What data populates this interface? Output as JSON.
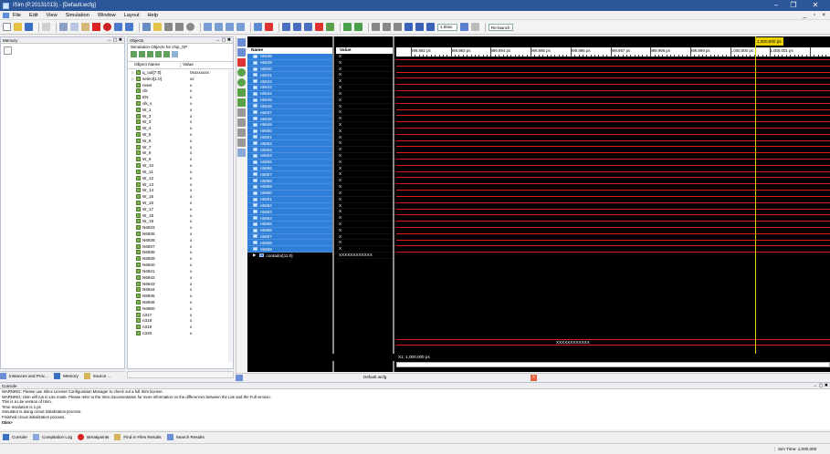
{
  "window": {
    "title": "ISim (P.20131013) - [Default.wcfg]",
    "min": "–",
    "max": "❐",
    "close": "✕",
    "inner_min": "_",
    "inner_restore": "▫",
    "inner_close": "×"
  },
  "menu": [
    "File",
    "Edit",
    "View",
    "Simulation",
    "Window",
    "Layout",
    "Help"
  ],
  "toolbar": {
    "run_time": "1.00us",
    "relaunch": "Re-launch",
    "icons": [
      "new-icon",
      "open-icon",
      "save-icon",
      "print-icon",
      "cut-icon",
      "copy-icon",
      "paste-icon",
      "delete-icon",
      "undo-icon",
      "redo-icon",
      "find-icon",
      "zoom-icon",
      "arrow-down-icon",
      "arrow-up-icon",
      "settings-icon",
      "layout-icon"
    ]
  },
  "memory_panel": {
    "title": "Memory"
  },
  "objects_panel": {
    "title": "Objects",
    "subtitle": "Simulation Objects for chip_SP",
    "col_name": "Object Name",
    "col_value": "Value",
    "rows": [
      {
        "name": "q_out[7:0]",
        "value": "0xxxxxxxx"
      },
      {
        "name": "select[1:0]",
        "value": "xx"
      },
      {
        "name": "reset",
        "value": "x"
      },
      {
        "name": "clk",
        "value": "x"
      },
      {
        "name": "EN",
        "value": "x"
      },
      {
        "name": "clk_s",
        "value": "x"
      },
      {
        "name": "W_1",
        "value": "x"
      },
      {
        "name": "W_2",
        "value": "x"
      },
      {
        "name": "W_3",
        "value": "x"
      },
      {
        "name": "W_4",
        "value": "x"
      },
      {
        "name": "W_5",
        "value": "x"
      },
      {
        "name": "W_6",
        "value": "x"
      },
      {
        "name": "W_7",
        "value": "x"
      },
      {
        "name": "W_8",
        "value": "x"
      },
      {
        "name": "W_9",
        "value": "x"
      },
      {
        "name": "W_10",
        "value": "x"
      },
      {
        "name": "W_11",
        "value": "x"
      },
      {
        "name": "W_12",
        "value": "x"
      },
      {
        "name": "W_13",
        "value": "x"
      },
      {
        "name": "W_14",
        "value": "x"
      },
      {
        "name": "W_15",
        "value": "x"
      },
      {
        "name": "W_16",
        "value": "x"
      },
      {
        "name": "W_17",
        "value": "x"
      },
      {
        "name": "W_18",
        "value": "x"
      },
      {
        "name": "W_19",
        "value": "x"
      },
      {
        "name": "N6933",
        "value": "x"
      },
      {
        "name": "N6935",
        "value": "x"
      },
      {
        "name": "N6936",
        "value": "x"
      },
      {
        "name": "N6937",
        "value": "x"
      },
      {
        "name": "N6938",
        "value": "x"
      },
      {
        "name": "N6939",
        "value": "x"
      },
      {
        "name": "N6940",
        "value": "x"
      },
      {
        "name": "N6941",
        "value": "x"
      },
      {
        "name": "N6942",
        "value": "x"
      },
      {
        "name": "N6943",
        "value": "x"
      },
      {
        "name": "N6944",
        "value": "x"
      },
      {
        "name": "N6945",
        "value": "x"
      },
      {
        "name": "N6946",
        "value": "x"
      },
      {
        "name": "N6960",
        "value": "x"
      },
      {
        "name": "n317",
        "value": "x"
      },
      {
        "name": "n318",
        "value": "x"
      },
      {
        "name": "n319",
        "value": "x"
      },
      {
        "name": "n320",
        "value": "x"
      }
    ]
  },
  "wave": {
    "col_name": "Name",
    "col_value": "Value",
    "marker": "1,000,000 ps",
    "time_labels": [
      "999,992 ps",
      "999,993 ps",
      "999,994 ps",
      "999,995 ps",
      "999,996 ps",
      "999,997 ps",
      "999,998 ps",
      "999,999 ps",
      "1,000,000 ps",
      "1,000,001 ps"
    ],
    "signals": [
      "n5638",
      "n5639",
      "n5640",
      "n5641",
      "n5642",
      "n5643",
      "n5644",
      "n5645",
      "n5646",
      "n5647",
      "n5648",
      "n5649",
      "n5650",
      "n5651",
      "n5652",
      "n5653",
      "n5654",
      "n5655",
      "n5656",
      "n5657",
      "n5658",
      "n5659",
      "n5660",
      "n5661",
      "n5662",
      "n5663",
      "n5664",
      "n5665",
      "n5666",
      "n5667",
      "n5668",
      "n5669"
    ],
    "signal_value": "X",
    "bus_name": "contador[11:0]",
    "bus_value": "XXXXXXXXXXXX",
    "bus_value_wave": "XXXXXXXXXXXX",
    "cursor_readout": "X1: 1,000,000 ps",
    "tab_label": "Default.wcfg"
  },
  "left_tabs": [
    {
      "label": "Instances and Proc..."
    },
    {
      "label": "Memory"
    },
    {
      "label": "Source ..."
    }
  ],
  "console": {
    "title": "Console",
    "lines": [
      "WARNING: Please use Xilinx License Configuration Manager to check out a full ISim license.",
      "WARNING: ISim will run in Lite mode. Please refer to the ISim documentation for more information on the differences between the Lite and the Full version.",
      "This is a Lite version of ISim.",
      "Time resolution is 1 ps",
      "Simulator is doing circuit initialization process.",
      "Finished circuit initialization process.",
      "ISim>"
    ],
    "tabs": [
      "Console",
      "Compilation Log",
      "Breakpoints",
      "Find in Files Results",
      "Search Results"
    ]
  },
  "status": {
    "sim_time": "Sim Time: 1,000,000"
  },
  "colors": {
    "accent": "#2b579a",
    "wave": "#e01b1b",
    "cursor": "#e8d000",
    "selection": "#2f7fd8"
  }
}
